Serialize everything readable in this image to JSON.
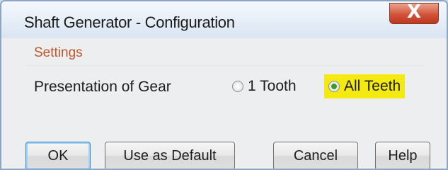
{
  "window": {
    "title": "Shaft Generator - Configuration",
    "close_label": "X"
  },
  "settings": {
    "group_label": "Settings",
    "presentation_label": "Presentation of Gear",
    "options": [
      {
        "label": "1 Tooth",
        "selected": false
      },
      {
        "label": "All Teeth",
        "selected": true,
        "highlight_color": "#f4ea12"
      }
    ]
  },
  "buttons": {
    "ok": "OK",
    "use_as_default": "Use as Default",
    "cancel": "Cancel",
    "help": "Help"
  },
  "colors": {
    "group_label": "#c2552c",
    "close_button": "#d2533a",
    "selected_radio_dot": "#3a9a36"
  },
  "icons": {
    "close": "close-icon",
    "radio": "radio-button"
  }
}
